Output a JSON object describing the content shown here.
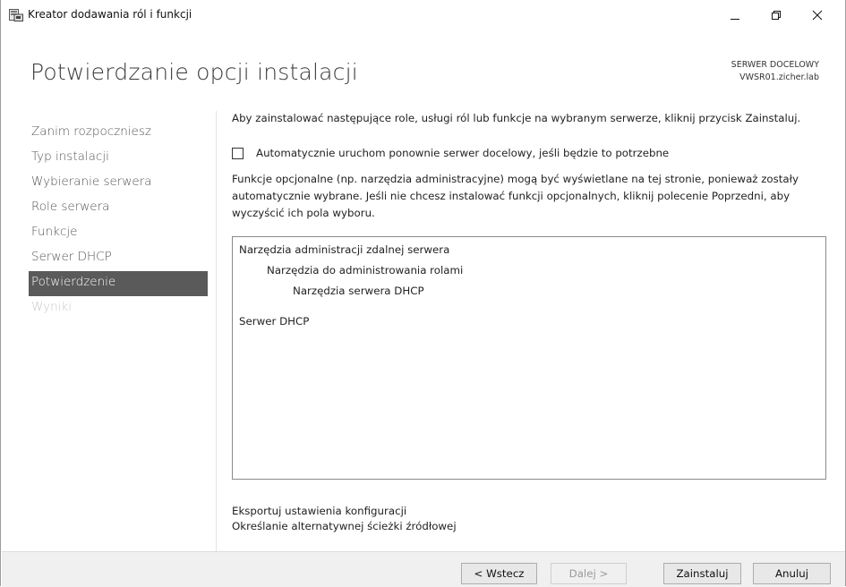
{
  "window": {
    "title": "Kreator dodawania ról i funkcji",
    "icon": "server-manager-icon"
  },
  "header": {
    "title": "Potwierdzanie opcji instalacji",
    "target_label": "SERWER DOCELOWY",
    "target_server": "VWSR01.zicher.lab"
  },
  "sidebar": {
    "items": [
      {
        "label": "Zanim rozpoczniesz",
        "state": "normal"
      },
      {
        "label": "Typ instalacji",
        "state": "normal"
      },
      {
        "label": "Wybieranie serwera",
        "state": "normal"
      },
      {
        "label": "Role serwera",
        "state": "normal"
      },
      {
        "label": "Funkcje",
        "state": "normal"
      },
      {
        "label": "Serwer DHCP",
        "state": "normal"
      },
      {
        "label": "Potwierdzenie",
        "state": "active"
      },
      {
        "label": "Wyniki",
        "state": "disabled"
      }
    ]
  },
  "main": {
    "intro": "Aby zainstalować następujące role, usługi ról lub funkcje na wybranym serwerze, kliknij przycisk Zainstaluj.",
    "restart_checkbox": {
      "label": "Automatycznie uruchom ponownie serwer docelowy, jeśli będzie to potrzebne",
      "checked": false
    },
    "note": "Funkcje opcjonalne (np. narzędzia administracyjne) mogą być wyświetlane na tej stronie, ponieważ zostały automatycznie wybrane. Jeśli nie chcesz instalować funkcji opcjonalnych, kliknij polecenie Poprzedni, aby wyczyścić ich pola wyboru.",
    "selection_items": [
      {
        "label": "Narzędzia administracji zdalnej serwera",
        "level": 0
      },
      {
        "label": "Narzędzia do administrowania rolami",
        "level": 1
      },
      {
        "label": "Narzędzia serwera DHCP",
        "level": 2
      },
      {
        "label": "Serwer DHCP",
        "level": 0
      }
    ],
    "links": {
      "export": "Eksportuj ustawienia konfiguracji",
      "alternate_source": "Określanie alternatywnej ścieżki źródłowej"
    }
  },
  "footer": {
    "previous": "< Wstecz",
    "next": "Dalej >",
    "install": "Zainstaluj",
    "cancel": "Anuluj"
  }
}
